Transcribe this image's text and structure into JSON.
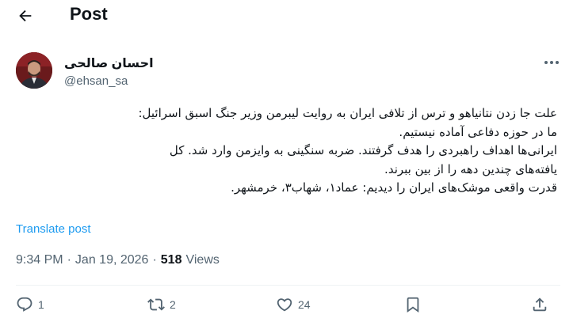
{
  "header": {
    "title": "Post",
    "back_icon": "arrow-left-icon"
  },
  "author": {
    "display_name": "احسان صالحی",
    "handle": "@ehsan_sa"
  },
  "tweet": {
    "lines": [
      "علت جا زدن نتانیاهو و ترس از تلافی ایران به روایت لیبرمن وزیر جنگ اسبق اسرائیل:",
      "ما در حوزه دفاعی آماده نیستیم.",
      "ایرانی‌ها اهداف راهبردی را هدف گرفتند. ضربه سنگینی به وایزمن وارد شد. کل",
      "یافته‌های چندین دهه را از بین ببرند.",
      "قدرت واقعی موشک‌های ایران را دیدیم: عماد۱، شهاب۳، خرمشهر."
    ],
    "translate_label": "Translate post"
  },
  "meta": {
    "time": "9:34 PM",
    "separator": "·",
    "date": "Jan 19, 2026",
    "views_count": "518",
    "views_label": "Views"
  },
  "actions": {
    "replies": "1",
    "reposts": "2",
    "likes": "24"
  },
  "colors": {
    "accent": "#1d9bf0",
    "text": "#0f1419",
    "muted": "#536471"
  }
}
